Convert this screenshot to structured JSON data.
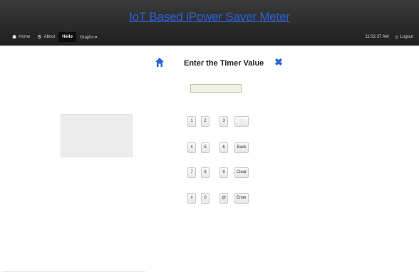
{
  "header": {
    "title": "IoT Based iPower Saver Meter",
    "nav": [
      {
        "icon": "home-icon",
        "label": "Home"
      },
      {
        "icon": "gear-icon",
        "label": "About"
      },
      {
        "icon": "",
        "label": "Hello",
        "active": true
      },
      {
        "icon": "",
        "label": "Graphs ▾"
      }
    ],
    "time": "11:02:37 AM",
    "logout_label": "Logout"
  },
  "dialog": {
    "title": "Enter the Timer Value",
    "input_value": ""
  },
  "keypad": {
    "rows": [
      [
        "1",
        "2",
        "3",
        ":"
      ],
      [
        "4",
        "5",
        "6",
        "Back"
      ],
      [
        "7",
        "8",
        "9",
        "Clear"
      ],
      [
        "#",
        "0",
        "@",
        "Enter"
      ]
    ]
  },
  "colors": {
    "accent": "#2a63d6",
    "header_bg": "#2b2b2b"
  }
}
